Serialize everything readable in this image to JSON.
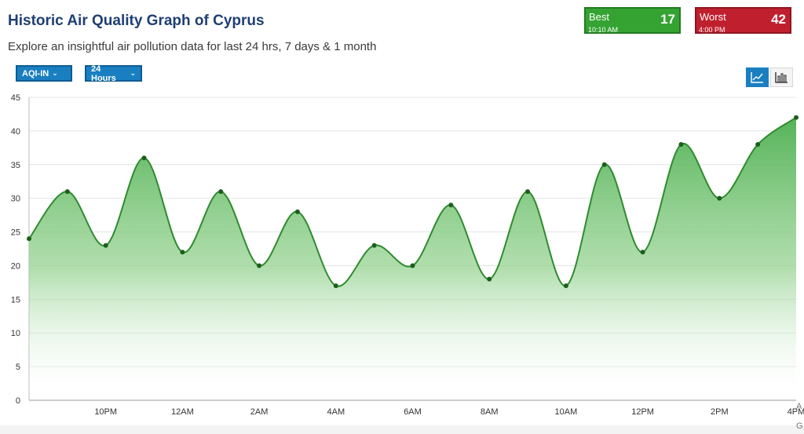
{
  "header": {
    "title": "Historic Air Quality Graph of Cyprus",
    "subtitle": "Explore an insightful air pollution data for last 24 hrs, 7 days & 1 month"
  },
  "controls": {
    "metric_select": "AQI-IN",
    "range_select": "24 Hours",
    "dropdown_chevron": "chevron-down-icon",
    "line_chart_toggle_icon": "line-chart-icon",
    "bar_chart_toggle_icon": "bar-chart-icon"
  },
  "summary": {
    "best": {
      "label": "Best",
      "time": "10:10 AM",
      "value": "17",
      "color": "#34a332"
    },
    "worst": {
      "label": "Worst",
      "time": "4:00 PM",
      "value": "42",
      "color": "#c0202e"
    }
  },
  "edge_text": {
    "right_top": "A",
    "right_bottom": "G"
  },
  "colors": {
    "accent": "#1a7fc1",
    "series_line": "#2e8b2e",
    "series_fill": "#4caf50",
    "marker": "#1d5e1d"
  },
  "chart_data": {
    "type": "area",
    "title": "",
    "xlabel": "",
    "ylabel": "",
    "ylim": [
      0,
      45
    ],
    "yticks": [
      0,
      5,
      10,
      15,
      20,
      25,
      30,
      35,
      40,
      45
    ],
    "xtick_labels": [
      "10PM",
      "12AM",
      "2AM",
      "4AM",
      "6AM",
      "8AM",
      "10AM",
      "12PM",
      "2PM",
      "4PM"
    ],
    "x": [
      0,
      1,
      2,
      3,
      4,
      5,
      6,
      7,
      8,
      9,
      10,
      11,
      12,
      13,
      14,
      15,
      16,
      17,
      18,
      19,
      20
    ],
    "grid": true,
    "series": [
      {
        "values": [
          24,
          31,
          23,
          36,
          22,
          31,
          20,
          28,
          17,
          23,
          20,
          29,
          18,
          31,
          17,
          35,
          22,
          38,
          30,
          38,
          42
        ]
      }
    ]
  }
}
